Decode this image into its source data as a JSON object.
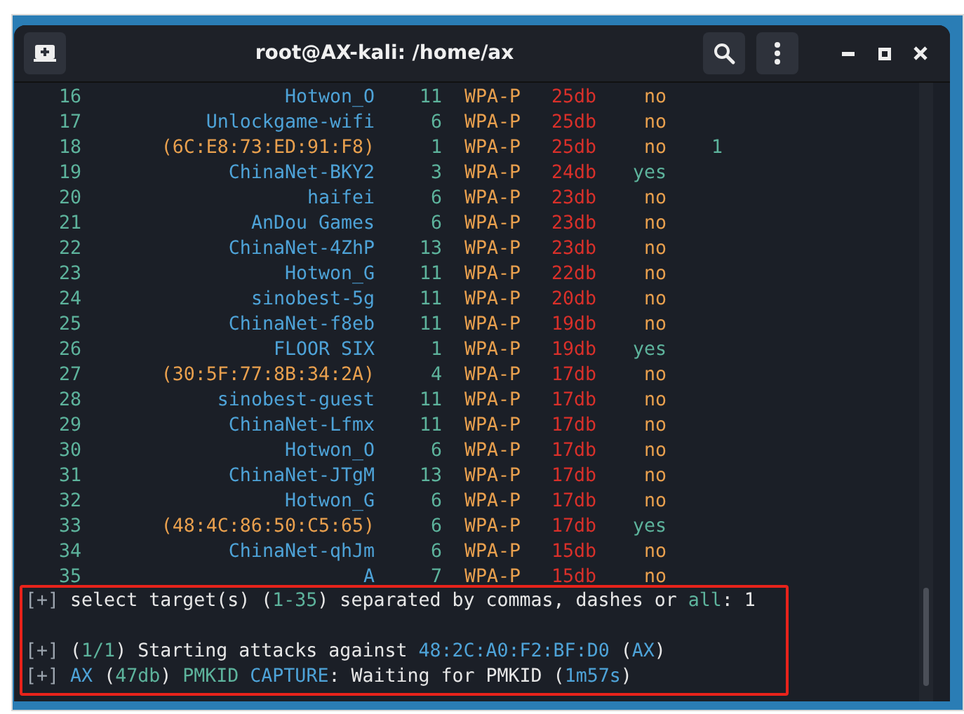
{
  "window": {
    "title": "root@AX-kali: /home/ax"
  },
  "targets": [
    {
      "num": "16",
      "essid": "Hotwon_O",
      "kind": "name",
      "channel": "11",
      "encryption": "WPA-P",
      "power": "25db",
      "wps": "no",
      "wps_enabled": false
    },
    {
      "num": "17",
      "essid": "Unlockgame-wifi",
      "kind": "name",
      "channel": "6",
      "encryption": "WPA-P",
      "power": "25db",
      "wps": "no",
      "wps_enabled": false
    },
    {
      "num": "18",
      "essid": "(6C:E8:73:ED:91:F8)",
      "kind": "mac",
      "channel": "1",
      "encryption": "WPA-P",
      "power": "25db",
      "wps": "no",
      "wps_enabled": false,
      "clients": "1"
    },
    {
      "num": "19",
      "essid": "ChinaNet-BKY2",
      "kind": "name",
      "channel": "3",
      "encryption": "WPA-P",
      "power": "24db",
      "wps": "yes",
      "wps_enabled": true
    },
    {
      "num": "20",
      "essid": "haifei",
      "kind": "name",
      "channel": "6",
      "encryption": "WPA-P",
      "power": "23db",
      "wps": "no",
      "wps_enabled": false
    },
    {
      "num": "21",
      "essid": "AnDou Games",
      "kind": "name",
      "channel": "6",
      "encryption": "WPA-P",
      "power": "23db",
      "wps": "no",
      "wps_enabled": false
    },
    {
      "num": "22",
      "essid": "ChinaNet-4ZhP",
      "kind": "name",
      "channel": "13",
      "encryption": "WPA-P",
      "power": "23db",
      "wps": "no",
      "wps_enabled": false
    },
    {
      "num": "23",
      "essid": "Hotwon_G",
      "kind": "name",
      "channel": "11",
      "encryption": "WPA-P",
      "power": "22db",
      "wps": "no",
      "wps_enabled": false
    },
    {
      "num": "24",
      "essid": "sinobest-5g",
      "kind": "name",
      "channel": "11",
      "encryption": "WPA-P",
      "power": "20db",
      "wps": "no",
      "wps_enabled": false
    },
    {
      "num": "25",
      "essid": "ChinaNet-f8eb",
      "kind": "name",
      "channel": "11",
      "encryption": "WPA-P",
      "power": "19db",
      "wps": "no",
      "wps_enabled": false
    },
    {
      "num": "26",
      "essid": "FLOOR SIX",
      "kind": "name",
      "channel": "1",
      "encryption": "WPA-P",
      "power": "19db",
      "wps": "yes",
      "wps_enabled": true
    },
    {
      "num": "27",
      "essid": "(30:5F:77:8B:34:2A)",
      "kind": "mac",
      "channel": "4",
      "encryption": "WPA-P",
      "power": "17db",
      "wps": "no",
      "wps_enabled": false
    },
    {
      "num": "28",
      "essid": "sinobest-guest",
      "kind": "name",
      "channel": "11",
      "encryption": "WPA-P",
      "power": "17db",
      "wps": "no",
      "wps_enabled": false
    },
    {
      "num": "29",
      "essid": "ChinaNet-Lfmx",
      "kind": "name",
      "channel": "11",
      "encryption": "WPA-P",
      "power": "17db",
      "wps": "no",
      "wps_enabled": false
    },
    {
      "num": "30",
      "essid": "Hotwon_O",
      "kind": "name",
      "channel": "6",
      "encryption": "WPA-P",
      "power": "17db",
      "wps": "no",
      "wps_enabled": false
    },
    {
      "num": "31",
      "essid": "ChinaNet-JTgM",
      "kind": "name",
      "channel": "13",
      "encryption": "WPA-P",
      "power": "17db",
      "wps": "no",
      "wps_enabled": false
    },
    {
      "num": "32",
      "essid": "Hotwon_G",
      "kind": "name",
      "channel": "6",
      "encryption": "WPA-P",
      "power": "17db",
      "wps": "no",
      "wps_enabled": false
    },
    {
      "num": "33",
      "essid": "(48:4C:86:50:C5:65)",
      "kind": "mac",
      "channel": "6",
      "encryption": "WPA-P",
      "power": "17db",
      "wps": "yes",
      "wps_enabled": true
    },
    {
      "num": "34",
      "essid": "ChinaNet-qhJm",
      "kind": "name",
      "channel": "6",
      "encryption": "WPA-P",
      "power": "15db",
      "wps": "no",
      "wps_enabled": false
    },
    {
      "num": "35",
      "essid": "A",
      "kind": "name",
      "channel": "7",
      "encryption": "WPA-P",
      "power": "15db",
      "wps": "no",
      "wps_enabled": false
    }
  ],
  "output_lines": [
    {
      "segments": [
        {
          "text": "[+]",
          "kind": "prefix"
        },
        {
          "text": " select target(s) (",
          "kind": "plain"
        },
        {
          "text": "1-35",
          "kind": "number"
        },
        {
          "text": ") separated by commas, dashes or ",
          "kind": "plain"
        },
        {
          "text": "all",
          "kind": "number"
        },
        {
          "text": ": 1",
          "kind": "plain"
        }
      ]
    },
    {
      "segments": [
        {
          "text": "[+]",
          "kind": "prefix"
        },
        {
          "text": " (",
          "kind": "plain"
        },
        {
          "text": "1/1",
          "kind": "number"
        },
        {
          "text": ") Starting attacks against ",
          "kind": "plain"
        },
        {
          "text": "48:2C:A0:F2:BF:D0",
          "kind": "name"
        },
        {
          "text": " (",
          "kind": "plain"
        },
        {
          "text": "AX",
          "kind": "name"
        },
        {
          "text": ")",
          "kind": "plain"
        }
      ]
    },
    {
      "segments": [
        {
          "text": "[+]",
          "kind": "prefix"
        },
        {
          "text": " AX",
          "kind": "name"
        },
        {
          "text": " (",
          "kind": "plain"
        },
        {
          "text": "47db",
          "kind": "number"
        },
        {
          "text": ") ",
          "kind": "plain"
        },
        {
          "text": "PMKID",
          "kind": "number"
        },
        {
          "text": " CAPTURE",
          "kind": "name"
        },
        {
          "text": ": Waiting for PMKID (",
          "kind": "plain"
        },
        {
          "text": "1m57s",
          "kind": "name"
        },
        {
          "text": ")",
          "kind": "plain"
        }
      ]
    }
  ]
}
